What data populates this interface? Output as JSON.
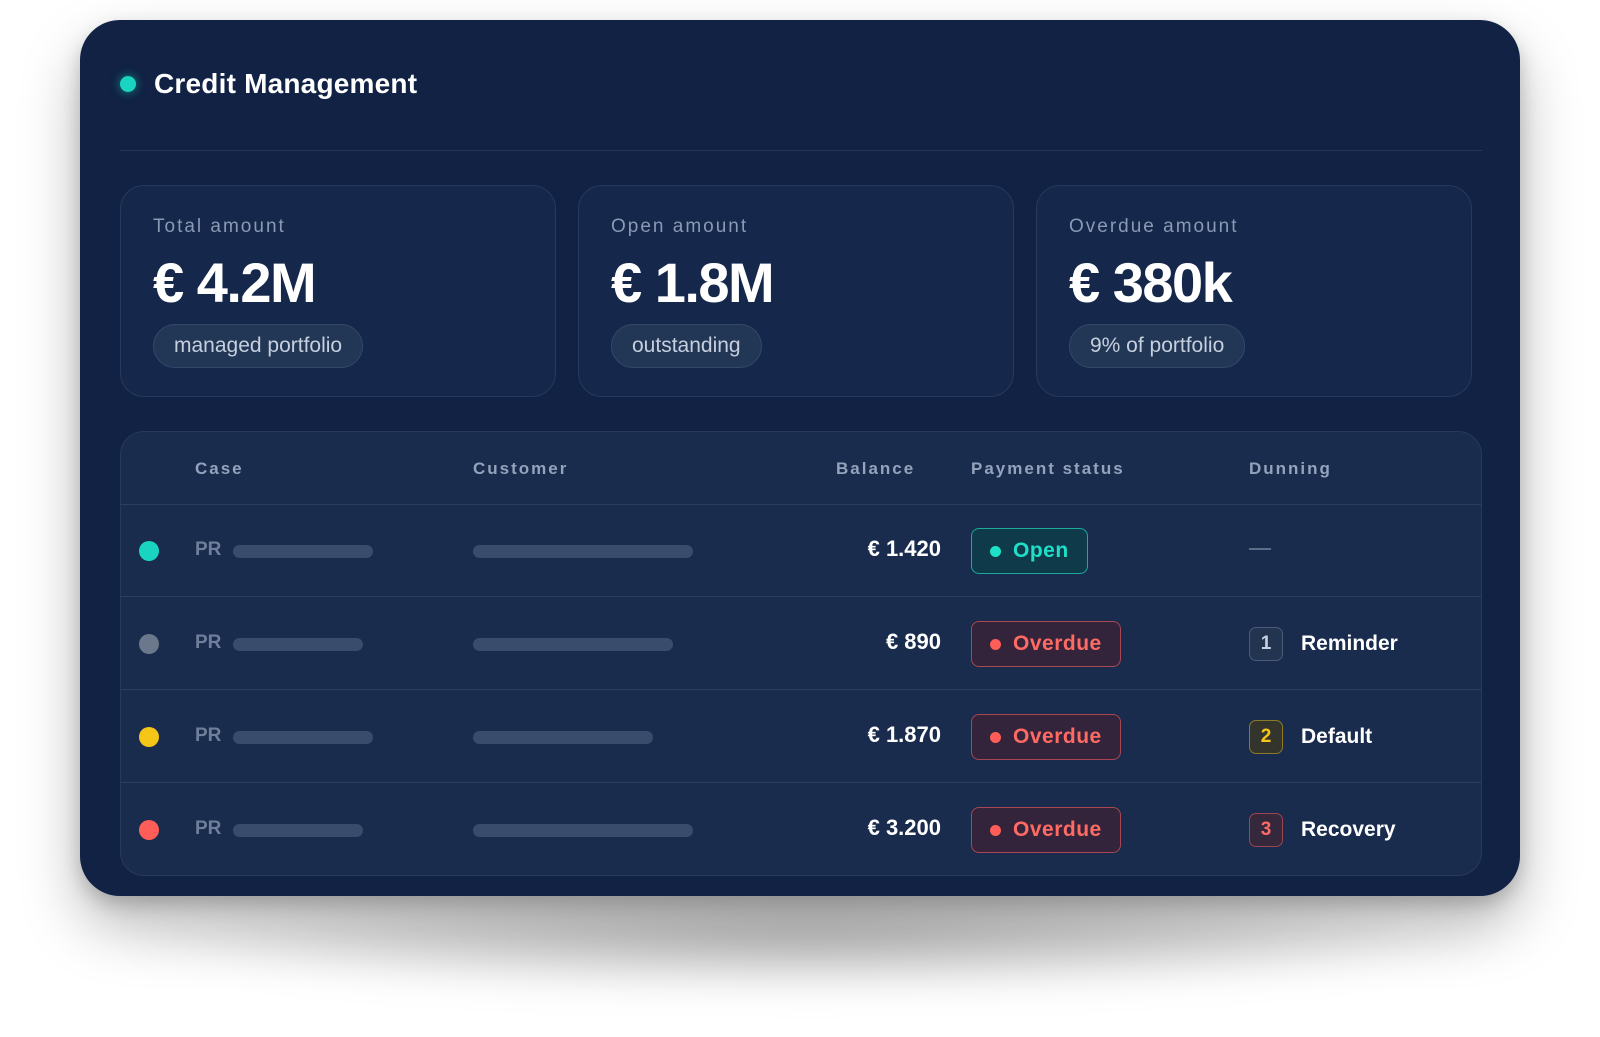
{
  "header": {
    "title": "Credit Management",
    "indicator_color": "#19d4c1"
  },
  "stats": [
    {
      "label": "Total amount",
      "value": "€ 4.2M",
      "pill": "managed portfolio"
    },
    {
      "label": "Open amount",
      "value": "€ 1.8M",
      "pill": "outstanding"
    },
    {
      "label": "Overdue amount",
      "value": "€ 380k",
      "pill": "9% of portfolio"
    }
  ],
  "table": {
    "columns": {
      "case": "Case",
      "customer": "Customer",
      "balance": "Balance",
      "payment_status": "Payment status",
      "dunning": "Dunning"
    },
    "rows": [
      {
        "indicator_color": "#19d4c1",
        "case_prefix": "PR",
        "balance": "€ 1.420",
        "status": "Open",
        "status_type": "open",
        "dunning_level": "",
        "dunning_label": "—"
      },
      {
        "indicator_color": "#6b778b",
        "case_prefix": "PR",
        "balance": "€ 890",
        "status": "Overdue",
        "status_type": "overdue",
        "dunning_level": "1",
        "dunning_label": "Reminder"
      },
      {
        "indicator_color": "#f5c518",
        "case_prefix": "PR",
        "balance": "€ 1.870",
        "status": "Overdue",
        "status_type": "overdue",
        "dunning_level": "2",
        "dunning_label": "Default"
      },
      {
        "indicator_color": "#ff5d57",
        "case_prefix": "PR",
        "balance": "€ 3.200",
        "status": "Overdue",
        "status_type": "overdue",
        "dunning_level": "3",
        "dunning_label": "Recovery"
      }
    ]
  }
}
